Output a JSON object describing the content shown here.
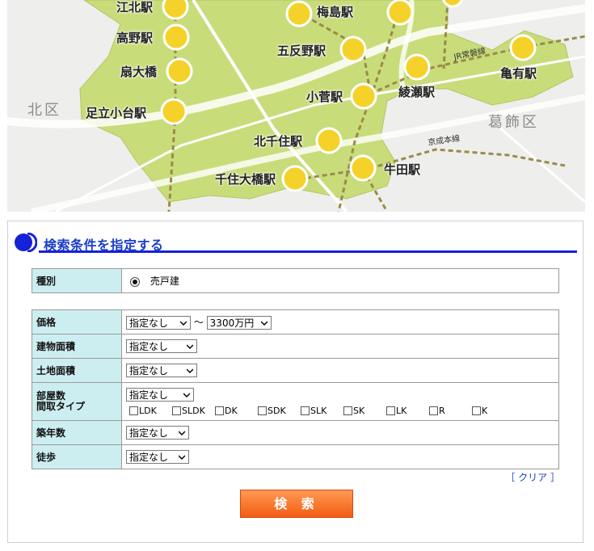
{
  "map": {
    "wards": {
      "kita": "北区",
      "katsushika": "葛飾区"
    },
    "lines": {
      "jr_joban": "JR常磐線",
      "keisei": "京成本線"
    },
    "stations": {
      "kohoku": "江北駅",
      "takano": "高野駅",
      "ogi_ohashi": "扇大橋",
      "adachi_odai": "足立小台駅",
      "umejima": "梅島駅",
      "gotanno": "五反野駅",
      "kosuge": "小菅駅",
      "ayase": "綾瀬駅",
      "kameari": "亀有駅",
      "kita_senju": "北千住駅",
      "senju_ohashi": "千住大橋駅",
      "ushida": "牛田駅"
    }
  },
  "search": {
    "heading": "検索条件を指定する",
    "type": {
      "label": "種別",
      "option": "売戸建"
    },
    "price": {
      "label": "価格",
      "min": "指定なし",
      "separator": "～",
      "max": "3300万円"
    },
    "building_area": {
      "label": "建物面積",
      "value": "指定なし"
    },
    "land_area": {
      "label": "土地面積",
      "value": "指定なし"
    },
    "rooms": {
      "label_line1": "部屋数",
      "label_line2": "間取タイプ",
      "value": "指定なし",
      "types": [
        "LDK",
        "SLDK",
        "DK",
        "SDK",
        "SLK",
        "SK",
        "LK",
        "R",
        "K"
      ]
    },
    "age": {
      "label": "築年数",
      "value": "指定なし"
    },
    "walk": {
      "label": "徒歩",
      "value": "指定なし"
    },
    "clear": "［ クリア ］",
    "button": "検 索"
  },
  "colors": {
    "heading_blue": "#1a3ccc",
    "label_bg": "#cdeef0",
    "button_orange": "#f35c14",
    "map_green": "#c9dc7a",
    "station_yellow": "#f5d22a"
  }
}
